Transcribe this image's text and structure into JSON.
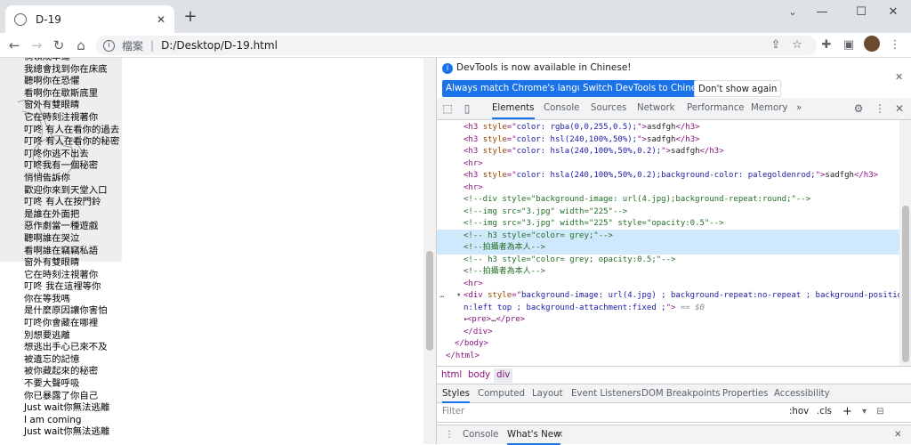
{
  "browser": {
    "tab_title": "D-19",
    "window_controls": {
      "minimize": "—",
      "maximize": "☐",
      "close": "✕"
    },
    "omnibox": {
      "security_label": "檔案",
      "url": "D:/Desktop/D-19.html"
    }
  },
  "page": {
    "lyrics": [
      "倘領成幸運",
      "我總會找到你在床底",
      "聽啊你在恐懼",
      "看啊你在歇斯底里",
      "窗外有雙眼睛",
      "它在時刻注視著你",
      "叮咚 有人在看你的過去",
      "叮咚 有人在看你的秘密",
      "叮咚你逃不出去",
      "叮咚我有一個秘密",
      "悄悄告訴你",
      "歡迎你來到天堂入口",
      "叮咚 有人在按門鈴",
      "是誰在外面把",
      "惡作劇當一種遊戲",
      "聽啊誰在哭泣",
      "看啊誰在竊竊私語",
      "窗外有雙眼睛",
      "它在時刻注視著你",
      "叮咚 我在這裡等你",
      "你在等我嗎",
      "是什麼原因讓你害怕",
      "叮咚你會藏在哪裡",
      "別想要逃離",
      "想逃出手心已來不及",
      "被遺忘的記憶",
      "被你藏起來的秘密",
      "不要大聲呼吸",
      "你已暴露了你自己",
      "Just wait你無法逃離",
      "I am coming",
      "Just wait你無法逃離"
    ]
  },
  "devtools": {
    "notice": {
      "text": "DevTools is now available in Chinese!",
      "btn_match": "Always match Chrome's language",
      "btn_switch": "Switch DevTools to Chinese",
      "btn_dismiss": "Don't show again"
    },
    "tabs": [
      "Elements",
      "Console",
      "Sources",
      "Network",
      "Performance",
      "Memory"
    ],
    "more": "»",
    "crumbs": [
      "html",
      "body",
      "div"
    ],
    "styles_tabs": [
      "Styles",
      "Computed",
      "Layout",
      "Event Listeners",
      "DOM Breakpoints",
      "Properties",
      "Accessibility"
    ],
    "filter_placeholder": "Filter",
    "filter_hov": ":hov",
    "filter_cls": ".cls",
    "filter_plus": "+",
    "drawer_tabs": [
      "Console",
      "What's New"
    ],
    "drawer_close": "×",
    "selected_marker": "== $0",
    "dots": "…"
  },
  "code_lines": [
    {
      "segs": [
        [
          "tg",
          "<h3 "
        ],
        [
          "at",
          "style"
        ],
        [
          "tg",
          "=\""
        ],
        [
          "av",
          "color: rgba(0,0,255,0.5);"
        ],
        [
          "tg",
          "\">"
        ],
        [
          "tx",
          "asdfgh"
        ],
        [
          "tg",
          "</h3>"
        ]
      ]
    },
    {
      "segs": [
        [
          "tg",
          "<h3 "
        ],
        [
          "at",
          "style"
        ],
        [
          "tg",
          "=\""
        ],
        [
          "av",
          "color: hsl(240,100%,50%);"
        ],
        [
          "tg",
          "\">"
        ],
        [
          "tx",
          "sadfgh"
        ],
        [
          "tg",
          "</h3>"
        ]
      ]
    },
    {
      "segs": [
        [
          "tg",
          "<h3 "
        ],
        [
          "at",
          "style"
        ],
        [
          "tg",
          "=\""
        ],
        [
          "av",
          "color: hsla(240,100%,50%,0.2);"
        ],
        [
          "tg",
          "\">"
        ],
        [
          "tx",
          "sadfgh"
        ],
        [
          "tg",
          "</h3>"
        ]
      ]
    },
    {
      "segs": [
        [
          "tg",
          "<hr>"
        ]
      ]
    },
    {
      "segs": [
        [
          "tg",
          "<h3 "
        ],
        [
          "at",
          "style"
        ],
        [
          "tg",
          "=\""
        ],
        [
          "av",
          "color: hsla(240,100%,50%,0.2);background-color: palegoldenrod;"
        ],
        [
          "tg",
          "\">"
        ],
        [
          "tx",
          "sadfgh"
        ],
        [
          "tg",
          "</h3>"
        ]
      ]
    },
    {
      "segs": [
        [
          "tg",
          "<hr>"
        ]
      ]
    },
    {
      "segs": [
        [
          "cm",
          "<!--div style=\"background-image: url(4.jpg);background-repeat:round;\"-->"
        ]
      ]
    },
    {
      "segs": [
        [
          "cm",
          "<!--img src=\"3.jpg\" width=\"225\"-->"
        ]
      ]
    },
    {
      "segs": [
        [
          "cm",
          "<!--img src=\"3.jpg\" width=\"225\" style=\"opacity:0.5\"-->"
        ]
      ]
    },
    {
      "segs": [
        [
          "cm",
          "<!-- h3 style=\"color= grey;\"-->"
        ]
      ]
    },
    {
      "segs": [
        [
          "cm",
          "<!--拍攝者為本人-->"
        ]
      ]
    },
    {
      "segs": [
        [
          "cm",
          "<!-- h3 style=\"color= grey; opacity:0.5;\"-->"
        ]
      ]
    },
    {
      "segs": [
        [
          "cm",
          "<!--拍攝者為本人-->"
        ]
      ]
    },
    {
      "segs": [
        [
          "tg",
          "<hr>"
        ]
      ]
    },
    {
      "segs": [
        [
          "tg",
          "<div "
        ],
        [
          "at",
          "style"
        ],
        [
          "tg",
          "=\""
        ],
        [
          "av",
          "background-image: url(4.jpg) ; background-repeat:no-repeat ; background-positio"
        ]
      ]
    },
    {
      "segs": [
        [
          "av",
          "n:left top ; background-attachment:fixed ;"
        ],
        [
          "tg",
          "\">"
        ]
      ]
    },
    {
      "segs": [
        [
          "tg",
          "<pre>"
        ],
        [
          "tx",
          "…"
        ],
        [
          "tg",
          "</pre>"
        ]
      ]
    },
    {
      "segs": [
        [
          "tg",
          "</div>"
        ]
      ]
    },
    {
      "segs": [
        [
          "tg",
          "</body>"
        ]
      ]
    },
    {
      "segs": [
        [
          "tg",
          "</html>"
        ]
      ]
    }
  ]
}
